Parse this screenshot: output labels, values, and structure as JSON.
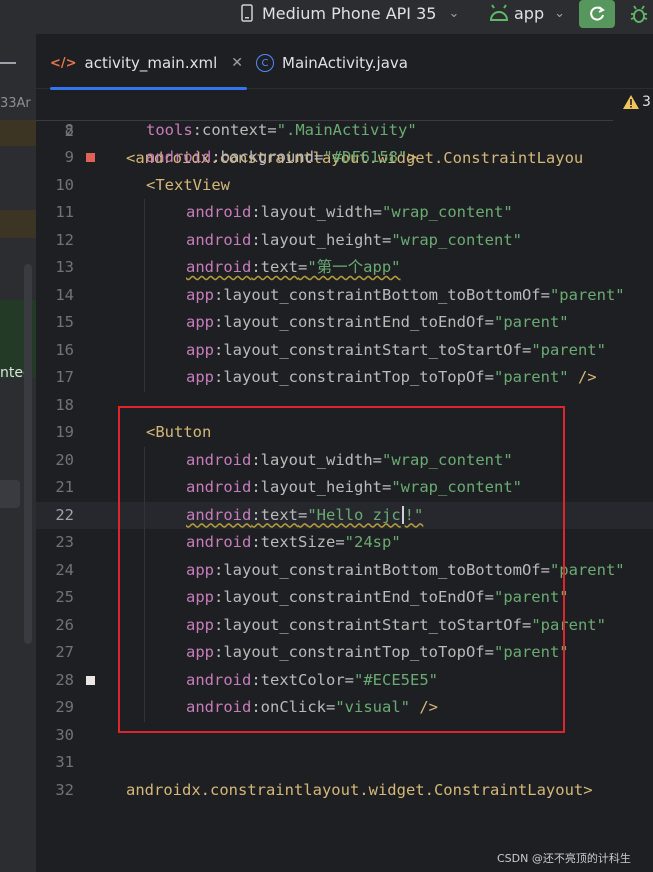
{
  "toolbar": {
    "device_label": "Medium Phone API 35",
    "run_config_label": "app",
    "colors": {
      "run_button": "#57965c",
      "android_icon": "#5fb865"
    }
  },
  "left_panel": {
    "fragment_top": "33Ar",
    "fragment_mid": "nted"
  },
  "tabs": [
    {
      "label": "activity_main.xml",
      "icon": "xml-file-icon",
      "active": true
    },
    {
      "label": "MainActivity.java",
      "icon": "java-class-icon",
      "active": false
    }
  ],
  "editor": {
    "warning_count": "3",
    "sticky_line": {
      "num": "2",
      "text": "<androidx.constraintlayout.widget.ConstraintLayou"
    },
    "lines": [
      {
        "num": "8",
        "parts": [
          [
            "ns",
            "tools"
          ],
          [
            "plain",
            ":"
          ],
          [
            "attr",
            "context"
          ],
          [
            "plain",
            "="
          ],
          [
            "val",
            "\".MainActivity\""
          ]
        ]
      },
      {
        "num": "9",
        "parts": [
          [
            "ns",
            "android"
          ],
          [
            "plain",
            ":"
          ],
          [
            "attr",
            "background"
          ],
          [
            "plain",
            "="
          ],
          [
            "val",
            "\"#DF6158\""
          ],
          [
            "tag",
            ">"
          ]
        ]
      },
      {
        "num": "10",
        "parts": [
          [
            "tag",
            "<TextView"
          ]
        ]
      },
      {
        "num": "11",
        "parts": [
          [
            "ns",
            "android"
          ],
          [
            "plain",
            ":"
          ],
          [
            "attr",
            "layout_width"
          ],
          [
            "plain",
            "="
          ],
          [
            "val",
            "\"wrap_content\""
          ]
        ]
      },
      {
        "num": "12",
        "parts": [
          [
            "ns",
            "android"
          ],
          [
            "plain",
            ":"
          ],
          [
            "attr",
            "layout_height"
          ],
          [
            "plain",
            "="
          ],
          [
            "val",
            "\"wrap_content\""
          ]
        ]
      },
      {
        "num": "13",
        "parts": [
          [
            "nsw",
            "android"
          ],
          [
            "plainw",
            ":"
          ],
          [
            "attrw",
            "text"
          ],
          [
            "plainw",
            "="
          ],
          [
            "valw",
            "\"第一个app\""
          ]
        ]
      },
      {
        "num": "14",
        "parts": [
          [
            "ns",
            "app"
          ],
          [
            "plain",
            ":"
          ],
          [
            "attr",
            "layout_constraintBottom_toBottomOf"
          ],
          [
            "plain",
            "="
          ],
          [
            "val",
            "\"parent\""
          ]
        ]
      },
      {
        "num": "15",
        "parts": [
          [
            "ns",
            "app"
          ],
          [
            "plain",
            ":"
          ],
          [
            "attr",
            "layout_constraintEnd_toEndOf"
          ],
          [
            "plain",
            "="
          ],
          [
            "val",
            "\"parent\""
          ]
        ]
      },
      {
        "num": "16",
        "parts": [
          [
            "ns",
            "app"
          ],
          [
            "plain",
            ":"
          ],
          [
            "attr",
            "layout_constraintStart_toStartOf"
          ],
          [
            "plain",
            "="
          ],
          [
            "val",
            "\"parent\""
          ]
        ]
      },
      {
        "num": "17",
        "parts": [
          [
            "ns",
            "app"
          ],
          [
            "plain",
            ":"
          ],
          [
            "attr",
            "layout_constraintTop_toTopOf"
          ],
          [
            "plain",
            "="
          ],
          [
            "val",
            "\"parent\""
          ],
          [
            "tag",
            " />"
          ]
        ]
      },
      {
        "num": "18",
        "parts": []
      },
      {
        "num": "19",
        "parts": [
          [
            "tag",
            "<Button"
          ]
        ]
      },
      {
        "num": "20",
        "parts": [
          [
            "ns",
            "android"
          ],
          [
            "plain",
            ":"
          ],
          [
            "attr",
            "layout_width"
          ],
          [
            "plain",
            "="
          ],
          [
            "val",
            "\"wrap_content\""
          ]
        ]
      },
      {
        "num": "21",
        "parts": [
          [
            "ns",
            "android"
          ],
          [
            "plain",
            ":"
          ],
          [
            "attr",
            "layout_height"
          ],
          [
            "plain",
            "="
          ],
          [
            "val",
            "\"wrap_content\""
          ]
        ]
      },
      {
        "num": "22",
        "parts": [
          [
            "nsw",
            "android"
          ],
          [
            "plainw",
            ":"
          ],
          [
            "attrw",
            "text"
          ],
          [
            "plainw",
            "="
          ],
          [
            "valw",
            "\"Hello zjc"
          ],
          [
            "caret",
            ""
          ],
          [
            "valw",
            "!\""
          ]
        ]
      },
      {
        "num": "23",
        "parts": [
          [
            "ns",
            "android"
          ],
          [
            "plain",
            ":"
          ],
          [
            "attr",
            "textSize"
          ],
          [
            "plain",
            "="
          ],
          [
            "val",
            "\"24sp\""
          ]
        ]
      },
      {
        "num": "24",
        "parts": [
          [
            "ns",
            "app"
          ],
          [
            "plain",
            ":"
          ],
          [
            "attr",
            "layout_constraintBottom_toBottomOf"
          ],
          [
            "plain",
            "="
          ],
          [
            "val",
            "\"parent\""
          ]
        ]
      },
      {
        "num": "25",
        "parts": [
          [
            "ns",
            "app"
          ],
          [
            "plain",
            ":"
          ],
          [
            "attr",
            "layout_constraintEnd_toEndOf"
          ],
          [
            "plain",
            "="
          ],
          [
            "val",
            "\"parent\""
          ]
        ]
      },
      {
        "num": "26",
        "parts": [
          [
            "ns",
            "app"
          ],
          [
            "plain",
            ":"
          ],
          [
            "attr",
            "layout_constraintStart_toStartOf"
          ],
          [
            "plain",
            "="
          ],
          [
            "val",
            "\"parent\""
          ]
        ]
      },
      {
        "num": "27",
        "parts": [
          [
            "ns",
            "app"
          ],
          [
            "plain",
            ":"
          ],
          [
            "attr",
            "layout_constraintTop_toTopOf"
          ],
          [
            "plain",
            "="
          ],
          [
            "val",
            "\"parent\""
          ]
        ]
      },
      {
        "num": "28",
        "parts": [
          [
            "ns",
            "android"
          ],
          [
            "plain",
            ":"
          ],
          [
            "attr",
            "textColor"
          ],
          [
            "plain",
            "="
          ],
          [
            "val",
            "\"#ECE5E5\""
          ]
        ]
      },
      {
        "num": "29",
        "parts": [
          [
            "ns",
            "android"
          ],
          [
            "plain",
            ":"
          ],
          [
            "attr",
            "onClick"
          ],
          [
            "plain",
            "="
          ],
          [
            "val",
            "\"visual\""
          ],
          [
            "tag",
            " />"
          ]
        ]
      },
      {
        "num": "30",
        "parts": []
      },
      {
        "num": "31",
        "parts": []
      },
      {
        "num": "32",
        "parts": [
          [
            "tag",
            "androidx.constraintlayout.widget.ConstraintLayout>"
          ]
        ]
      }
    ],
    "color_markers": {
      "9": "#DF6158",
      "28": "#ECE5E5"
    },
    "current_line": "22"
  },
  "watermark": "CSDN @还不亮顶的计科生"
}
